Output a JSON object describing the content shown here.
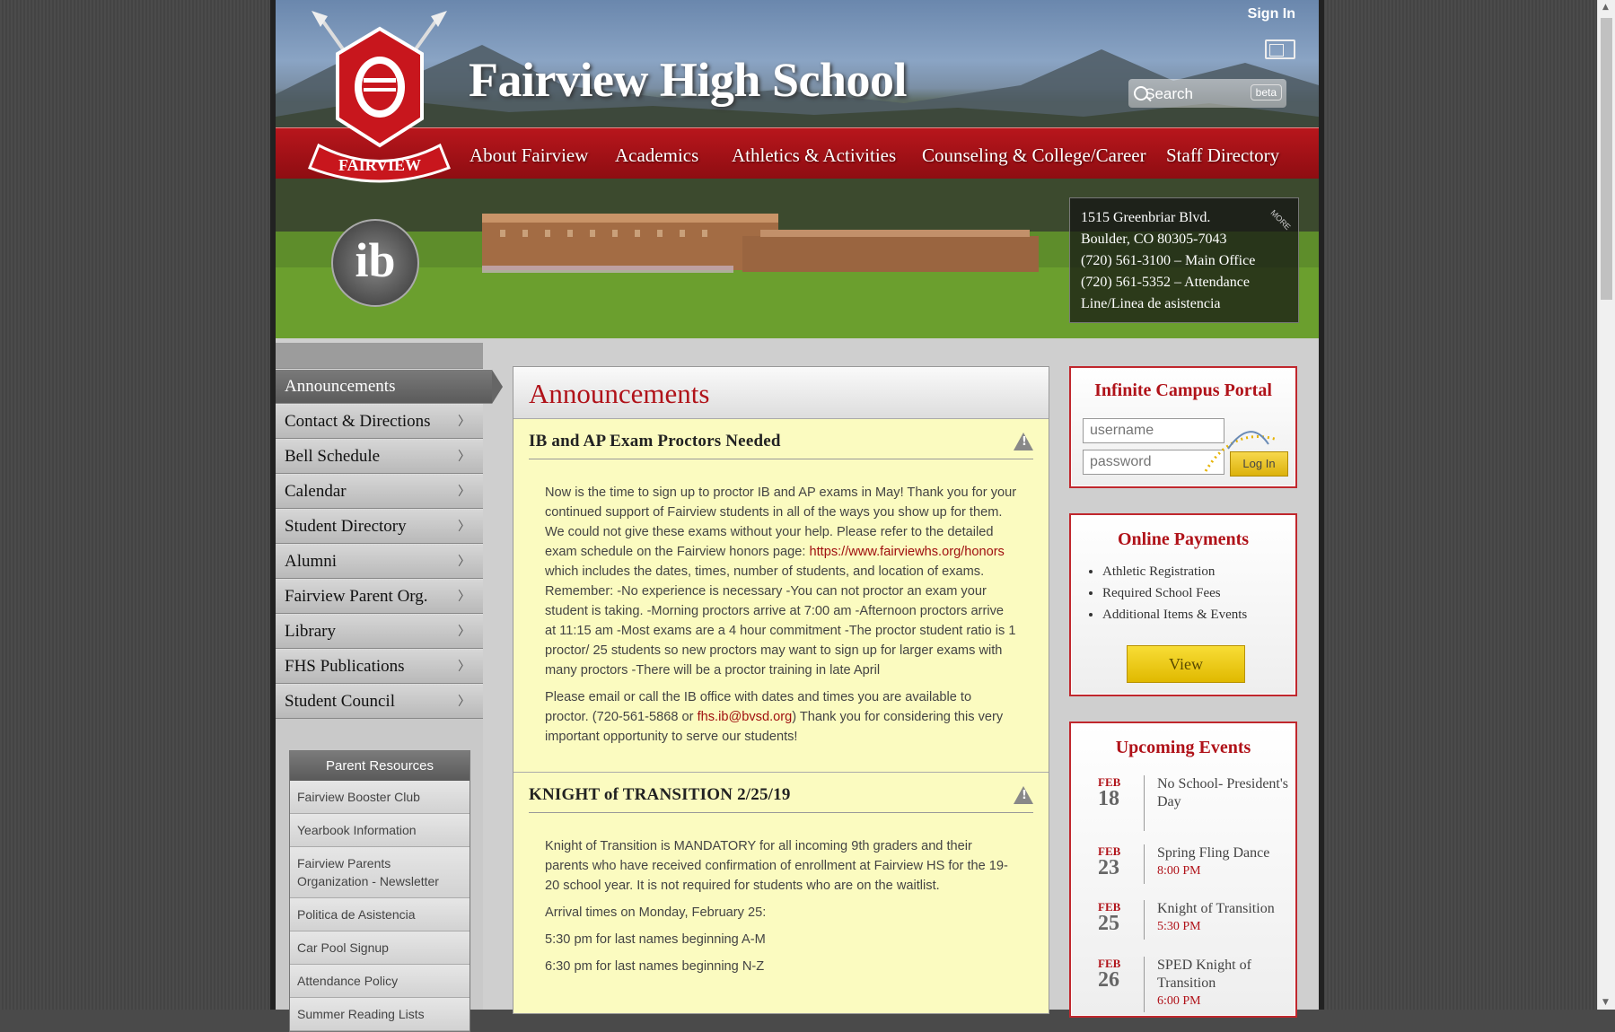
{
  "colors": {
    "brand_red": "#b01219",
    "nav_red": "#a0141a",
    "announcement_bg": "#fbfbc0",
    "button_yellow": "#f2cc1a"
  },
  "header": {
    "sign_in": "Sign In",
    "title": "Fairview High School",
    "search_label": "Search",
    "search_badge": "beta",
    "logo_text": "FAIRVIEW",
    "ib_text": "ib",
    "contact": {
      "line1": "1515 Greenbriar Blvd.",
      "line2": "Boulder, CO 80305-7043",
      "line3": "(720) 561-3100  –  Main Office",
      "line4": "(720) 561-5352  –  Attendance",
      "line5": "Line/Linea de asistencia",
      "more": "MORE"
    },
    "nav": [
      "About Fairview",
      "Academics",
      "Athletics & Activities",
      "Counseling & College/Career",
      "Staff Directory"
    ]
  },
  "sidebar": {
    "items": [
      {
        "label": "Announcements",
        "active": true
      },
      {
        "label": "Contact & Directions"
      },
      {
        "label": "Bell Schedule"
      },
      {
        "label": "Calendar"
      },
      {
        "label": "Student Directory"
      },
      {
        "label": "Alumni"
      },
      {
        "label": "Fairview Parent Org."
      },
      {
        "label": "Library"
      },
      {
        "label": "FHS Publications"
      },
      {
        "label": "Student Council"
      }
    ],
    "parent_resources": {
      "title": "Parent Resources",
      "links": [
        "Fairview Booster Club",
        "Yearbook Information",
        "Fairview Parents Organization - Newsletter",
        "Politica de Asistencia",
        "Car Pool Signup",
        "Attendance Policy",
        "Summer Reading Lists"
      ]
    }
  },
  "main": {
    "heading": "Announcements",
    "posts": [
      {
        "title": "IB and AP Exam Proctors Needed",
        "p1_a": "Now is the time to sign up to proctor IB and AP exams in May! Thank you for your continued support of Fairview students in all of the ways you show up for them. We could not give these exams without your help. Please refer to the detailed exam schedule on the Fairview honors page:",
        "link": "https://www.fairviewhs.org/honors",
        "p1_b": " which includes the dates, times, number of students, and location of exams. Remember: -No experience is necessary -You can not proctor an exam your student is taking. -Morning proctors arrive at 7:00 am -Afternoon proctors arrive at 11:15 am -Most exams are a 4 hour commitment -The proctor student ratio is 1 proctor/ 25 students so new proctors may want to sign up for larger exams with many proctors -There will be a proctor training in late April",
        "p2_a": "Please email or call the IB office with dates and times you are available to proctor. (720-561-5868 or ",
        "email": "fhs.ib@bvsd.org",
        "p2_b": ") Thank you for considering this very important opportunity to serve our students!"
      },
      {
        "title": "KNIGHT of TRANSITION 2/25/19",
        "p1": "Knight of Transition is MANDATORY for all incoming 9th graders and their parents who have received confirmation of enrollment at Fairview HS for the 19-20 school year. It is not required for students who are on the waitlist.",
        "p2": "Arrival times on Monday, February 25:",
        "p3": "5:30 pm for last names beginning A-M",
        "p4": "6:30 pm for last names beginning N-Z"
      }
    ]
  },
  "campus_portal": {
    "title": "Infinite Campus Portal",
    "username_placeholder": "username",
    "password_placeholder": "password",
    "login_label": "Log In"
  },
  "payments": {
    "title": "Online Payments",
    "items": [
      "Athletic Registration",
      "Required School Fees",
      "Additional Items & Events"
    ],
    "button": "View"
  },
  "events": {
    "title": "Upcoming Events",
    "list": [
      {
        "month": "FEB",
        "day": "18",
        "name": "No School- President's Day",
        "time": ""
      },
      {
        "month": "FEB",
        "day": "23",
        "name": "Spring Fling Dance",
        "time": "8:00 PM"
      },
      {
        "month": "FEB",
        "day": "25",
        "name": "Knight of Transition",
        "time": "5:30 PM"
      },
      {
        "month": "FEB",
        "day": "26",
        "name": "SPED Knight of Transition",
        "time": "6:00 PM"
      }
    ]
  }
}
